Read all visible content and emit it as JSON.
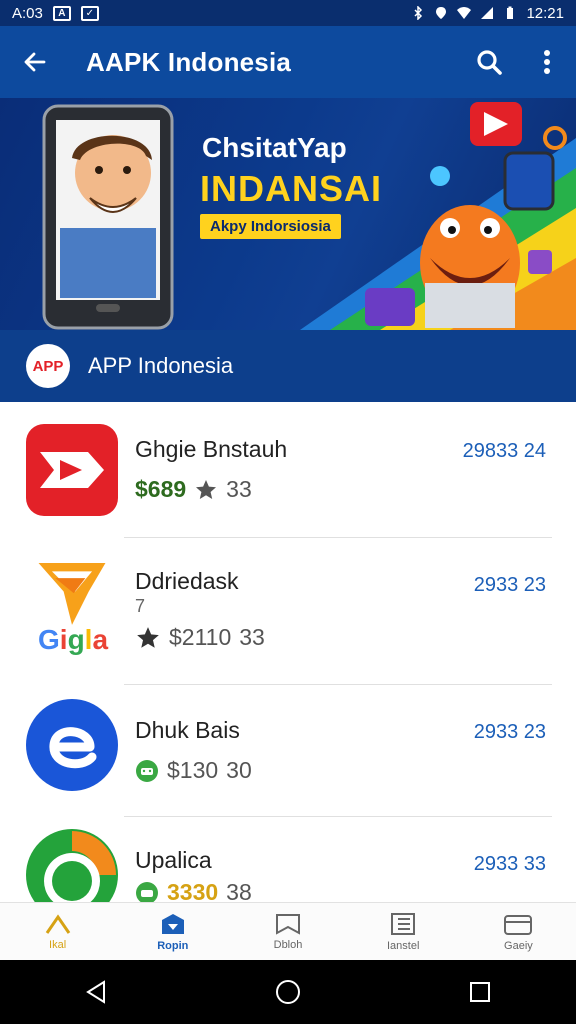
{
  "status_bar": {
    "time_left": "A:03",
    "time_right": "12:21"
  },
  "app_bar": {
    "title": "AAPK Indonesia"
  },
  "banner": {
    "headline1": "ChsitatYap",
    "headline2": "INDANSAI",
    "pill": "Akpy Indorsiosia"
  },
  "section": {
    "logo_text": "APP",
    "label": "APP Indonesia"
  },
  "apps": [
    {
      "name": "Ghgie Bnstauh",
      "price": "$689",
      "rating": "33",
      "size": "29833 24",
      "price_color": "#2e6b1f",
      "icon": "red-play-icon"
    },
    {
      "name": "Ddriedask",
      "sub": "7",
      "price": "$2110",
      "rating": "33",
      "size": "2933 23",
      "icon": "orange-bird-icon",
      "icon_text": "Gigla"
    },
    {
      "name": "Dhuk Bais",
      "price": "$130",
      "rating": "30",
      "size": "2933 23",
      "icon": "blue-e-icon"
    },
    {
      "name": "Upalica",
      "price": "3330",
      "rating": "38",
      "size": "2933 33",
      "price_color": "#d6a214",
      "icon": "green-chat-icon"
    }
  ],
  "bottom_nav": [
    {
      "label": "Ikal",
      "icon": "home-icon"
    },
    {
      "label": "Ropin",
      "icon": "store-icon"
    },
    {
      "label": "Dbloh",
      "icon": "bookmark-icon"
    },
    {
      "label": "Ianstel",
      "icon": "list-icon"
    },
    {
      "label": "Gaeiy",
      "icon": "card-icon"
    }
  ],
  "colors": {
    "app_bar": "#0d4a9e",
    "status_bar": "#0a2e6e",
    "accent_blue": "#1c5fb8",
    "accent_gold": "#d6a214"
  }
}
